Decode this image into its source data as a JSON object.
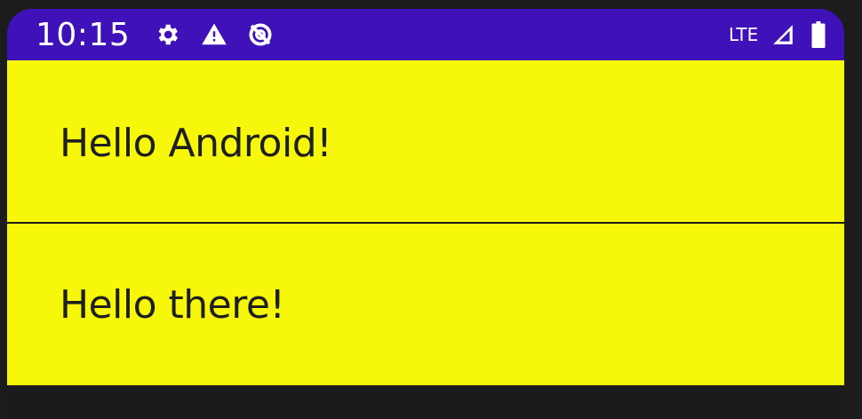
{
  "status_bar": {
    "time": "10:15",
    "network_label": "LTE",
    "icons": [
      "settings-gear-icon",
      "warning-icon",
      "data-saver-icon",
      "signal-icon",
      "battery-icon"
    ],
    "background": "#3e12b8"
  },
  "content": {
    "background": "#f7f70c",
    "items": [
      {
        "text": "Hello Android!"
      },
      {
        "text": "Hello there!"
      }
    ]
  }
}
